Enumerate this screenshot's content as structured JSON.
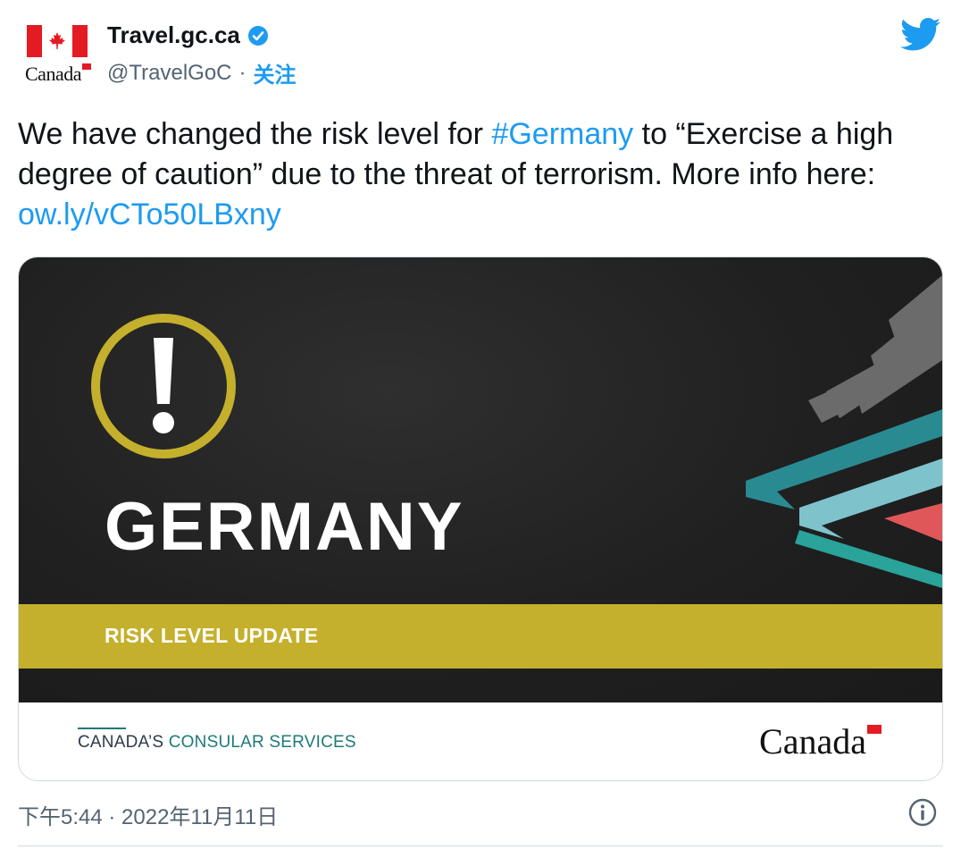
{
  "author": {
    "display_name": "Travel.gc.ca",
    "handle": "@TravelGoC",
    "separator": "·",
    "follow_label": "关注",
    "avatar_wordmark": "Canada"
  },
  "tweet": {
    "text_before": "We have changed the risk level for ",
    "hashtag": "#Germany",
    "text_after": " to “Exercise a high degree of caution” due to the threat of terrorism. More info here: ",
    "link": "ow.ly/vCTo50LBxny"
  },
  "card": {
    "country": "GERMANY",
    "risk_label": "RISK LEVEL UPDATE",
    "footer_prefix": "CANADA’S ",
    "footer_accent": "CONSULAR SERVICES",
    "wordmark": "Canada"
  },
  "meta": {
    "timestamp": "下午5:44 · 2022年11月11日"
  },
  "icons": [
    "canada-flag-icon",
    "verified-badge-icon",
    "twitter-bird-icon",
    "warning-exclamation-icon",
    "info-icon"
  ],
  "colors": {
    "link": "#1d9bf0",
    "flag_red": "#e31b23",
    "risk_band": "#c4b02c",
    "teal": "#1f7a7a"
  }
}
